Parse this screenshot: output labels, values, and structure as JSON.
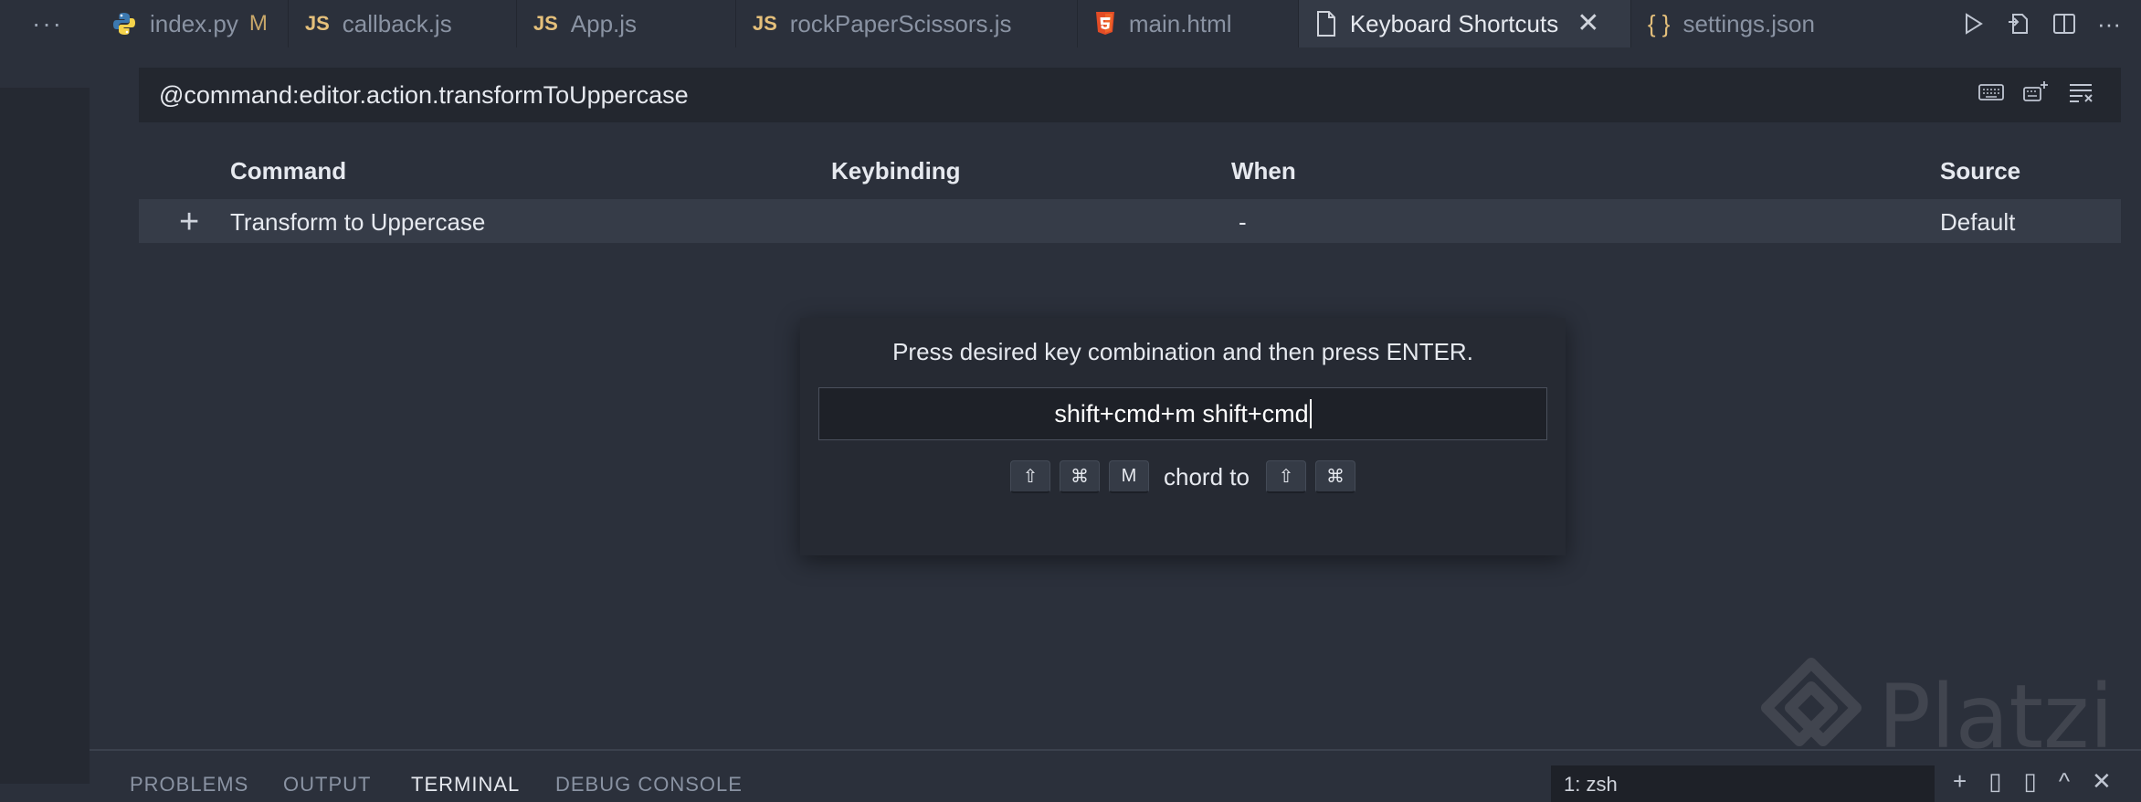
{
  "tabbar": {
    "more": "···",
    "tabs": [
      {
        "label": "index.py",
        "icon": "python-icon",
        "badge": "M"
      },
      {
        "label": "callback.js",
        "icon": "js-icon",
        "icon_text": "JS"
      },
      {
        "label": "App.js",
        "icon": "js-icon",
        "icon_text": "JS"
      },
      {
        "label": "rockPaperScissors.js",
        "icon": "js-icon",
        "icon_text": "JS"
      },
      {
        "label": "main.html",
        "icon": "html5-icon"
      },
      {
        "label": "Keyboard Shortcuts",
        "icon": "file-icon",
        "active": true,
        "close": "✕"
      },
      {
        "label": "settings.json",
        "icon": "json-icon",
        "icon_text": "{ }"
      }
    ],
    "more_actions": "···"
  },
  "search": {
    "value": "@command:editor.action.transformToUppercase"
  },
  "table": {
    "headers": {
      "command": "Command",
      "keybinding": "Keybinding",
      "when": "When",
      "source": "Source"
    },
    "rows": [
      {
        "command": "Transform to Uppercase",
        "keybinding": "",
        "when": "-",
        "source": "Default"
      }
    ]
  },
  "dialog": {
    "message": "Press desired key combination and then press ENTER.",
    "input_value": "shift+cmd+m shift+cmd",
    "keys_first": [
      "⇧",
      "⌘",
      "M"
    ],
    "chord_label": "chord to",
    "keys_second": [
      "⇧",
      "⌘"
    ]
  },
  "watermark": {
    "text": "Platzi"
  },
  "panel": {
    "tabs": [
      "PROBLEMS",
      "OUTPUT",
      "TERMINAL",
      "DEBUG CONSOLE"
    ],
    "active_tab": "TERMINAL",
    "terminal_select": "1: zsh"
  },
  "colors": {
    "background": "#2b303b",
    "active_tab": "#343a46",
    "js_icon": "#e5c07b",
    "html_icon": "#e34c26",
    "python_blue": "#3b78b0",
    "python_yellow": "#f5d34b"
  }
}
